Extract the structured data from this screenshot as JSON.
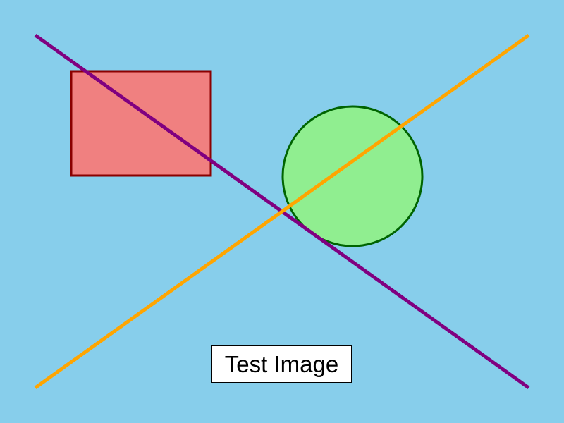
{
  "caption": {
    "text": "Test Image"
  },
  "colors": {
    "background": "#87CEEB",
    "rectangle_fill": "#F08080",
    "rectangle_stroke": "#8B0000",
    "circle_fill": "#90EE90",
    "circle_stroke": "#006400",
    "diagonal_line_1": "#800080",
    "diagonal_line_2": "#FFA500",
    "caption_background": "#FFFFFF",
    "caption_border": "#000000"
  }
}
